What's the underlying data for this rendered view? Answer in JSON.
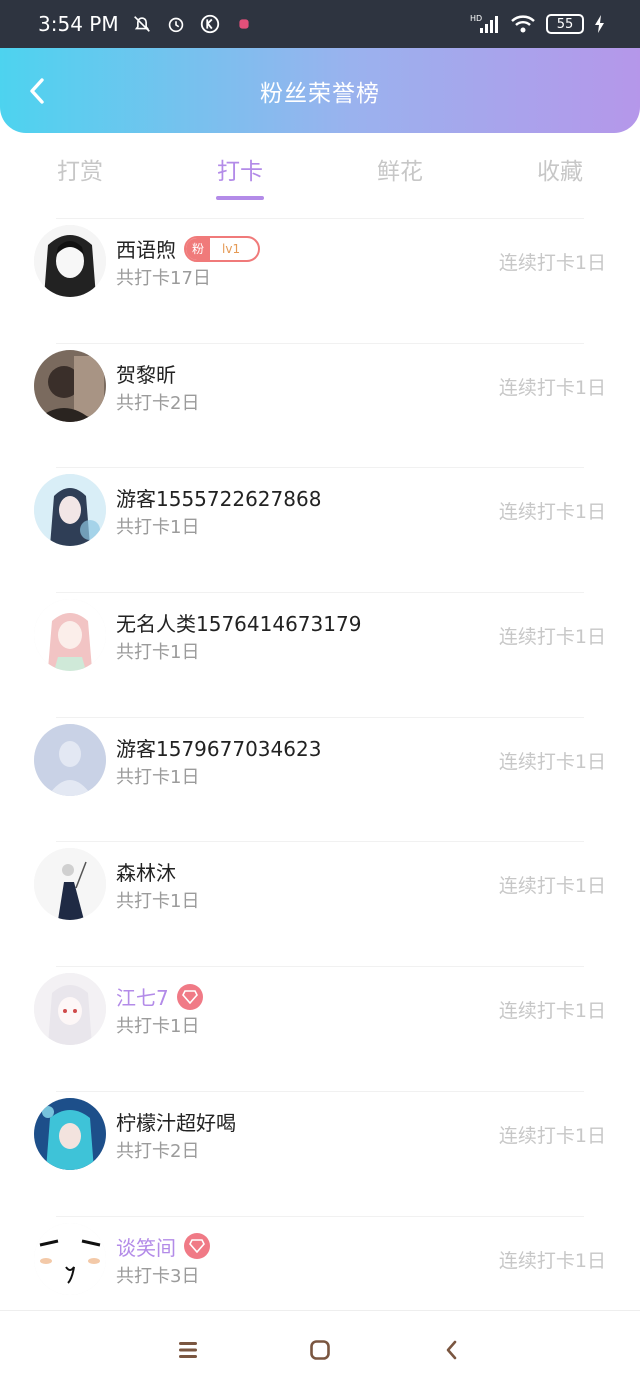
{
  "status_bar": {
    "time": "3:54 PM",
    "battery": "55",
    "network": "HD"
  },
  "header": {
    "title": "粉丝荣誉榜",
    "gradient_start": "#4dd3ef",
    "gradient_end": "#b597ea"
  },
  "tabs": [
    {
      "label": "打赏",
      "active": false
    },
    {
      "label": "打卡",
      "active": true
    },
    {
      "label": "鲜花",
      "active": false
    },
    {
      "label": "收藏",
      "active": false
    }
  ],
  "accent_color": "#b38be8",
  "list": [
    {
      "name": "西语煦",
      "total": "共打卡17日",
      "streak": "连续打卡1日",
      "badge": {
        "fan": "粉",
        "level": "lv1"
      },
      "vip": false
    },
    {
      "name": "贺黎昕",
      "total": "共打卡2日",
      "streak": "连续打卡1日",
      "vip": false
    },
    {
      "name": "游客1555722627868",
      "total": "共打卡1日",
      "streak": "连续打卡1日",
      "vip": false
    },
    {
      "name": "无名人类1576414673179",
      "total": "共打卡1日",
      "streak": "连续打卡1日",
      "vip": false
    },
    {
      "name": "游客1579677034623",
      "total": "共打卡1日",
      "streak": "连续打卡1日",
      "vip": false
    },
    {
      "name": "森林沐",
      "total": "共打卡1日",
      "streak": "连续打卡1日",
      "vip": false
    },
    {
      "name": "江七7",
      "total": "共打卡1日",
      "streak": "连续打卡1日",
      "vip": true
    },
    {
      "name": "柠檬汁超好喝",
      "total": "共打卡2日",
      "streak": "连续打卡1日",
      "vip": false
    },
    {
      "name": "谈笑间",
      "total": "共打卡3日",
      "streak": "连续打卡1日",
      "vip": true
    }
  ],
  "icons": {
    "back": "chevron-left-icon",
    "vip": "diamond-icon",
    "nav_menu": "menu-icon",
    "nav_home": "home-square-icon",
    "nav_back": "back-chevron-icon"
  }
}
